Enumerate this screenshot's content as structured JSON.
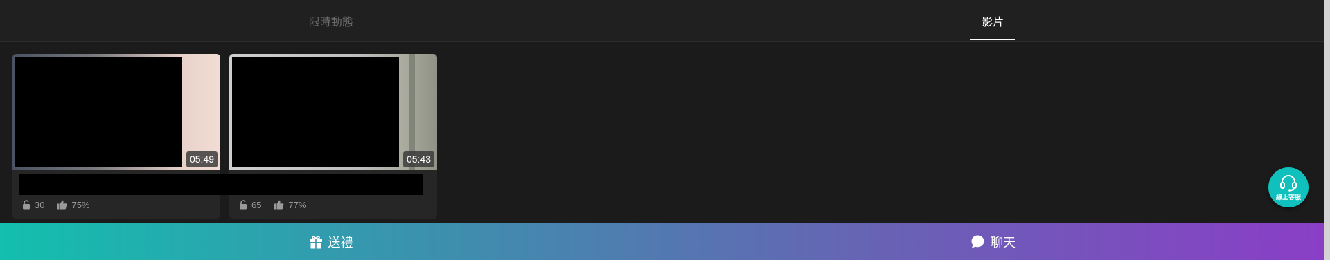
{
  "tabs": [
    {
      "label": "限時動態",
      "active": false
    },
    {
      "label": "影片",
      "active": true
    }
  ],
  "videos": [
    {
      "duration": "05:49",
      "locks": "30",
      "like_rate": "75%"
    },
    {
      "duration": "05:43",
      "locks": "65",
      "like_rate": "77%"
    }
  ],
  "actions": {
    "gift_label": "送禮",
    "chat_label": "聊天"
  },
  "support": {
    "label": "線上客服"
  },
  "colors": {
    "background": "#1b1b1b",
    "gradient_start": "#13bfae",
    "gradient_end": "#8a3ec6",
    "support_button": "#10c0bd"
  },
  "icons": [
    "lock-icon",
    "thumbs-up-icon",
    "gift-icon",
    "chat-bubble-icon",
    "headset-icon"
  ]
}
